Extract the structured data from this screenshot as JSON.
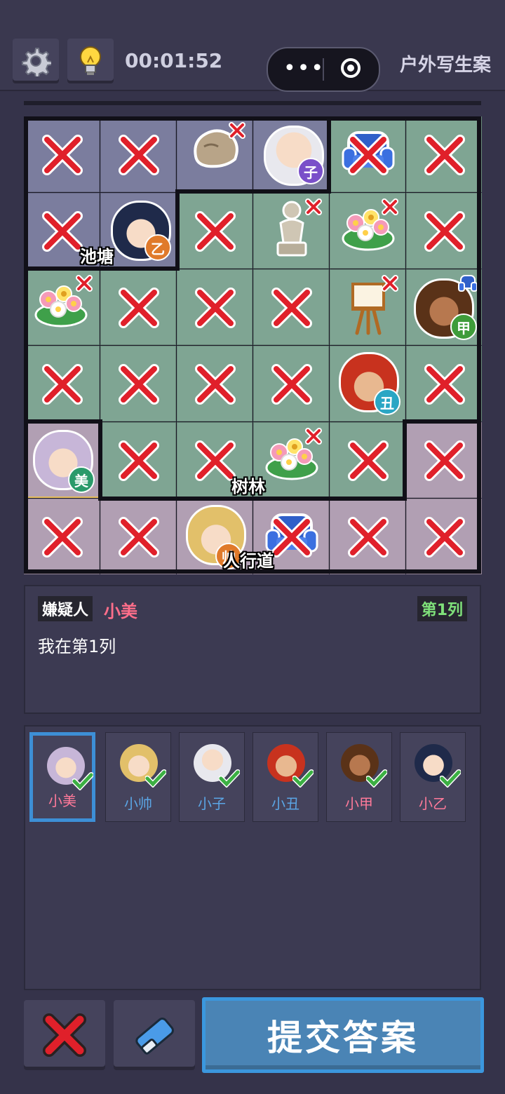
{
  "header": {
    "timer": "00:01:52",
    "case_title": "户外写生案",
    "capsule_dots": "•••"
  },
  "board": {
    "regions": [
      "池塘",
      "树林",
      "人行道"
    ],
    "suspect_badges": [
      "子",
      "乙",
      "甲",
      "丑",
      "美",
      "帅"
    ]
  },
  "clue": {
    "tag": "嫌疑人",
    "suspect": "小美",
    "column_tag": "第1列",
    "text": "我在第1列"
  },
  "suspects": [
    {
      "name": "小美",
      "checked": true,
      "selected": true,
      "color": "#ff7a9a"
    },
    {
      "name": "小帅",
      "checked": true,
      "selected": false,
      "color": "#5ba6e6"
    },
    {
      "name": "小子",
      "checked": true,
      "selected": false,
      "color": "#5ba6e6"
    },
    {
      "name": "小丑",
      "checked": true,
      "selected": false,
      "color": "#5ba6e6"
    },
    {
      "name": "小甲",
      "checked": true,
      "selected": false,
      "color": "#ff7a9a"
    },
    {
      "name": "小乙",
      "checked": true,
      "selected": false,
      "color": "#ff7a9a"
    }
  ],
  "actions": {
    "submit_label": "提交答案"
  },
  "colors": {
    "pond": "#7b7d9e",
    "forest": "#7fa593",
    "sidewalk": "#b19fb3",
    "accent": "#3d8fd6"
  }
}
